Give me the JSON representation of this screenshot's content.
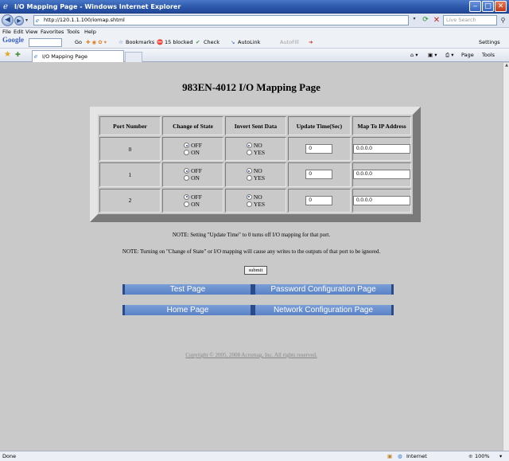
{
  "window": {
    "title": "I/O Mapping Page - Windows Internet Explorer"
  },
  "address": {
    "url": "http://120.1.1.100/iomap.shtml",
    "search_placeholder": "Live Search"
  },
  "menu": [
    "File",
    "Edit",
    "View",
    "Favorites",
    "Tools",
    "Help"
  ],
  "google_bar": {
    "logo": "Google",
    "go": "Go",
    "bookmarks": "Bookmarks",
    "blocked": "15 blocked",
    "check": "Check",
    "autolink": "AutoLink",
    "autofill": "AutoFill",
    "settings": "Settings"
  },
  "tabs": {
    "active": "I/O Mapping Page",
    "page": "Page",
    "tools": "Tools"
  },
  "page": {
    "title": "983EN-4012 I/O Mapping Page",
    "table": {
      "headers": [
        "Port Number",
        "Change of State",
        "Invert Sent Data",
        "Update Time(Sec)",
        "Map To IP Address"
      ],
      "rows": [
        {
          "port": "0",
          "update_time": "0",
          "ip": "0.0.0.0"
        },
        {
          "port": "1",
          "update_time": "0",
          "ip": "0.0.0.0"
        },
        {
          "port": "2",
          "update_time": "0",
          "ip": "0.0.0.0"
        }
      ],
      "cos_options": [
        "OFF",
        "ON"
      ],
      "invert_options": [
        "NO",
        "YES"
      ]
    },
    "note1": "NOTE: Setting \"Update Time\" to 0 turns off I/O mapping for that port.",
    "note2": "NOTE: Turning on \"Change of State\" or I/O mapping will cause any writes to the outputs of that port to be ignored.",
    "submit": "submit",
    "links": {
      "test": "Test Page",
      "password": "Password Configuration Page",
      "home": "Home Page",
      "network": "Network Configuration Page"
    },
    "copyright": "Copyright © 2005, 2008 Acromag, Inc. All rights reserved."
  },
  "status": {
    "left": "Done",
    "zone": "Internet",
    "zoom": "100%"
  }
}
